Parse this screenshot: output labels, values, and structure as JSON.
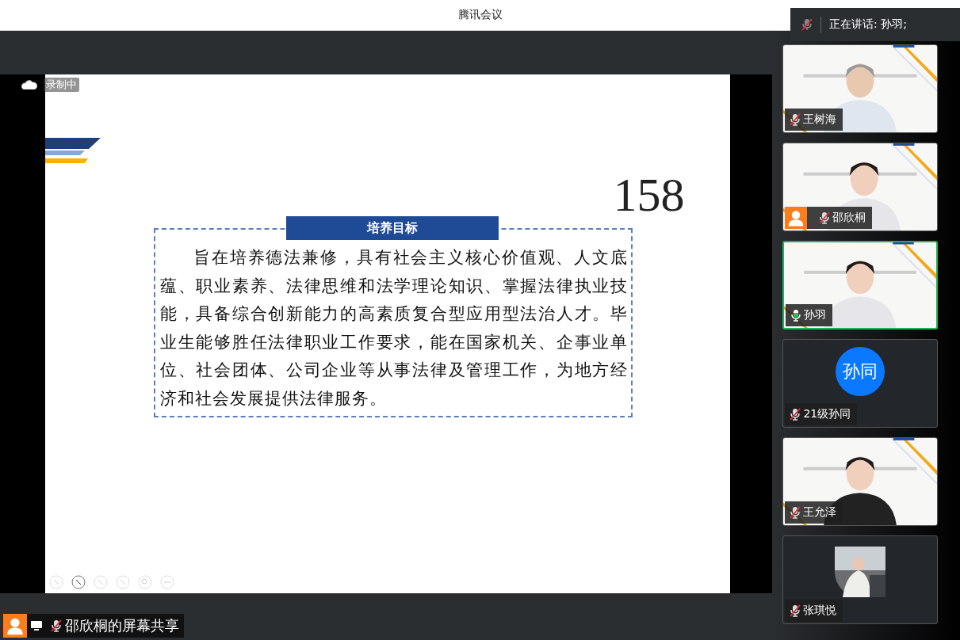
{
  "window": {
    "title": "腾讯会议"
  },
  "speaking": {
    "label": "正在讲话: 孙羽;"
  },
  "share": {
    "recording": "录制中",
    "slide_number": "158",
    "box_title": "培养目标",
    "paragraph": "旨在培养德法兼修，具有社会主义核心价值观、人文底蕴、职业素养、法律思维和法学理论知识、掌握法律执业技能，具备综合创新能力的高素质复合型应用型法治人才。毕业生能够胜任法律职业工作要求，能在国家机关、企事业单位、社会团体、公司企业等从事法律及管理工作，为地方经济和社会发展提供法律服务。"
  },
  "sharer": {
    "label": "邵欣桐的屏幕共享",
    "host": true,
    "muted": true
  },
  "participants": [
    {
      "kind": "video",
      "name": "王树海",
      "muted": true,
      "speaking": false,
      "host": false
    },
    {
      "kind": "video",
      "name": "邵欣桐",
      "muted": true,
      "speaking": false,
      "host": true
    },
    {
      "kind": "video",
      "name": "孙羽",
      "muted": false,
      "speaking": true,
      "host": false
    },
    {
      "kind": "initials",
      "name": "21级孙同",
      "initials": "孙同",
      "muted": true,
      "speaking": false,
      "host": false
    },
    {
      "kind": "video",
      "name": "王允泽",
      "muted": true,
      "speaking": false,
      "host": false
    },
    {
      "name": "张琪悦",
      "muted": true,
      "speaking": false,
      "host": false
    }
  ]
}
